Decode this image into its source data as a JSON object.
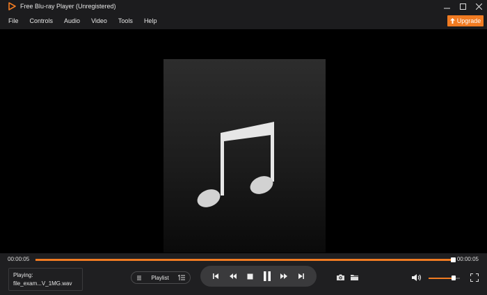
{
  "window": {
    "title": "Free Blu-ray Player (Unregistered)",
    "logo_icon": "play-triangle-logo-icon"
  },
  "menu": {
    "items": [
      "File",
      "Controls",
      "Audio",
      "Video",
      "Tools",
      "Help"
    ],
    "upgrade_label": "Upgrade"
  },
  "player": {
    "artwork_icon": "music-note-icon",
    "time_current": "00:00:05",
    "time_total": "00:00:05",
    "progress_fraction": 1.0,
    "now_playing_label": "Playing:",
    "now_playing_file": "file_exam...V_1MG.wav",
    "playlist_label": "Playlist",
    "volume_fraction": 0.8
  },
  "colors": {
    "accent": "#f17b22",
    "bar_bg": "#1f1f21",
    "titlebar_bg": "#1c1c1e"
  }
}
